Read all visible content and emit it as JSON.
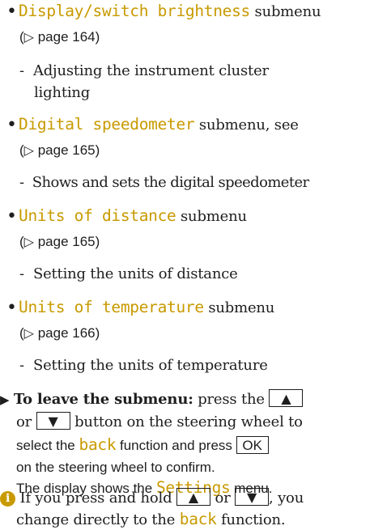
{
  "items": [
    {
      "title": "Display/switch brightness",
      "after": "submenu",
      "page_ref": "page 164",
      "sub": "Adjusting the instrument cluster",
      "sub2": "lighting"
    },
    {
      "title": "Digital speedometer",
      "after": "submenu, see",
      "page_ref": "page 165",
      "sub": "Shows and sets the digital speedometer"
    },
    {
      "title": "Units of distance",
      "after": "submenu",
      "page_ref": "page 165",
      "sub": "Setting the units of distance"
    },
    {
      "title": "Units of temperature",
      "after": "submenu",
      "page_ref": "page 166",
      "sub": "Setting the units of temperature"
    }
  ],
  "instruction": {
    "lead": "To leave the submenu:",
    "t1": "press the",
    "t2": "or",
    "t3": "button on the steering wheel to",
    "t4": "select the",
    "back": "back",
    "t5": "function and press",
    "ok": "OK",
    "t6": "on the steering wheel to confirm.",
    "t7": "The display shows the",
    "settings": "Settings",
    "t8": "menu."
  },
  "note": {
    "icon": "i",
    "t1": "If you press and hold",
    "t2": "or",
    "t3": ", you",
    "t4": "change directly to the",
    "back": "back",
    "t5": "function."
  },
  "glyphs": {
    "bullet": "•",
    "ref_arrow": "▷",
    "dash": "-",
    "step": "▶",
    "up": "▲",
    "down": "▼"
  },
  "colors": {
    "accent": "#c89a00",
    "text": "#1e1e1e"
  }
}
